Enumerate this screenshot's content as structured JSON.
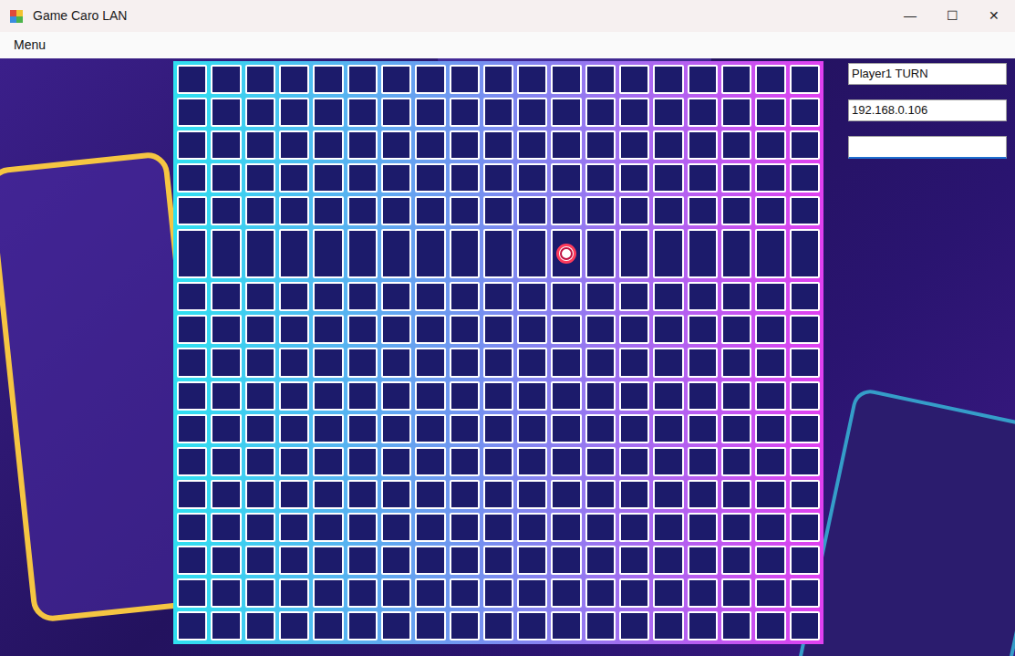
{
  "window": {
    "title": "Game Caro LAN",
    "controls": [
      "—",
      "☐",
      "✕"
    ]
  },
  "menu": [
    "Menu"
  ],
  "board": {
    "rows": [
      [
        "",
        "",
        "",
        "",
        "",
        "",
        "",
        "",
        "",
        "",
        "",
        "",
        "",
        "",
        "",
        "",
        "",
        "",
        ""
      ],
      [
        "",
        "",
        "",
        "",
        "",
        "",
        "",
        "",
        "",
        "",
        "",
        "",
        "",
        "",
        "",
        "",
        "",
        "",
        ""
      ],
      [
        "",
        "",
        "",
        "",
        "",
        "",
        "",
        "",
        "",
        "",
        "",
        "",
        "",
        "",
        "",
        "",
        "",
        "",
        ""
      ],
      [
        "",
        "",
        "",
        "",
        "",
        "",
        "",
        "",
        "",
        "",
        "",
        "",
        "",
        "",
        "",
        "",
        "",
        "",
        ""
      ],
      [
        "",
        "",
        "",
        "",
        "",
        "",
        "",
        "",
        "",
        "",
        "",
        "",
        "",
        "",
        "",
        "",
        "",
        "",
        ""
      ],
      [
        "",
        "",
        "",
        "",
        "",
        "",
        "",
        "",
        "",
        "",
        "",
        "O",
        "",
        "",
        "",
        "",
        "",
        "",
        ""
      ],
      [
        "",
        "",
        "",
        "",
        "",
        "",
        "",
        "",
        "",
        "",
        "",
        "",
        "",
        "",
        "",
        "",
        "",
        "",
        ""
      ],
      [
        "",
        "",
        "",
        "",
        "",
        "",
        "",
        "",
        "",
        "",
        "",
        "",
        "",
        "",
        "",
        "",
        "",
        "",
        ""
      ],
      [
        "",
        "",
        "",
        "",
        "",
        "",
        "",
        "",
        "",
        "",
        "",
        "",
        "",
        "",
        "",
        "",
        "",
        "",
        ""
      ],
      [
        "",
        "",
        "",
        "",
        "",
        "",
        "",
        "",
        "",
        "",
        "",
        "",
        "",
        "",
        "",
        "",
        "",
        "",
        ""
      ],
      [
        "",
        "",
        "",
        "",
        "",
        "",
        "",
        "",
        "",
        "",
        "",
        "",
        "",
        "",
        "",
        "",
        "",
        "",
        ""
      ],
      [
        "",
        "",
        "",
        "",
        "",
        "",
        "",
        "",
        "",
        "",
        "",
        "",
        "",
        "",
        "",
        "",
        "",
        "",
        ""
      ],
      [
        "",
        "",
        "",
        "",
        "",
        "",
        "",
        "",
        "",
        "",
        "",
        "",
        "",
        "",
        "",
        "",
        "",
        "",
        ""
      ],
      [
        "",
        "",
        "",
        "",
        "",
        "",
        "",
        "",
        "",
        "",
        "",
        "",
        "",
        "",
        "",
        "",
        "",
        "",
        ""
      ],
      [
        "",
        "",
        "",
        "",
        "",
        "",
        "",
        "",
        "",
        "",
        "",
        "",
        "",
        "",
        "",
        "",
        "",
        "",
        ""
      ],
      [
        "",
        "",
        "",
        "",
        "",
        "",
        "",
        "",
        "",
        "",
        "",
        "",
        "",
        "",
        "",
        "",
        "",
        "",
        ""
      ],
      [
        "",
        "",
        "",
        "",
        "",
        "",
        "",
        "",
        "",
        "",
        "",
        "",
        "",
        "",
        "",
        "",
        "",
        "",
        ""
      ]
    ]
  },
  "fields": [
    {
      "value": "Player1 TURN",
      "focused": false
    },
    {
      "value": "192.168.0.106",
      "focused": false
    },
    {
      "value": "",
      "focused": true
    }
  ]
}
